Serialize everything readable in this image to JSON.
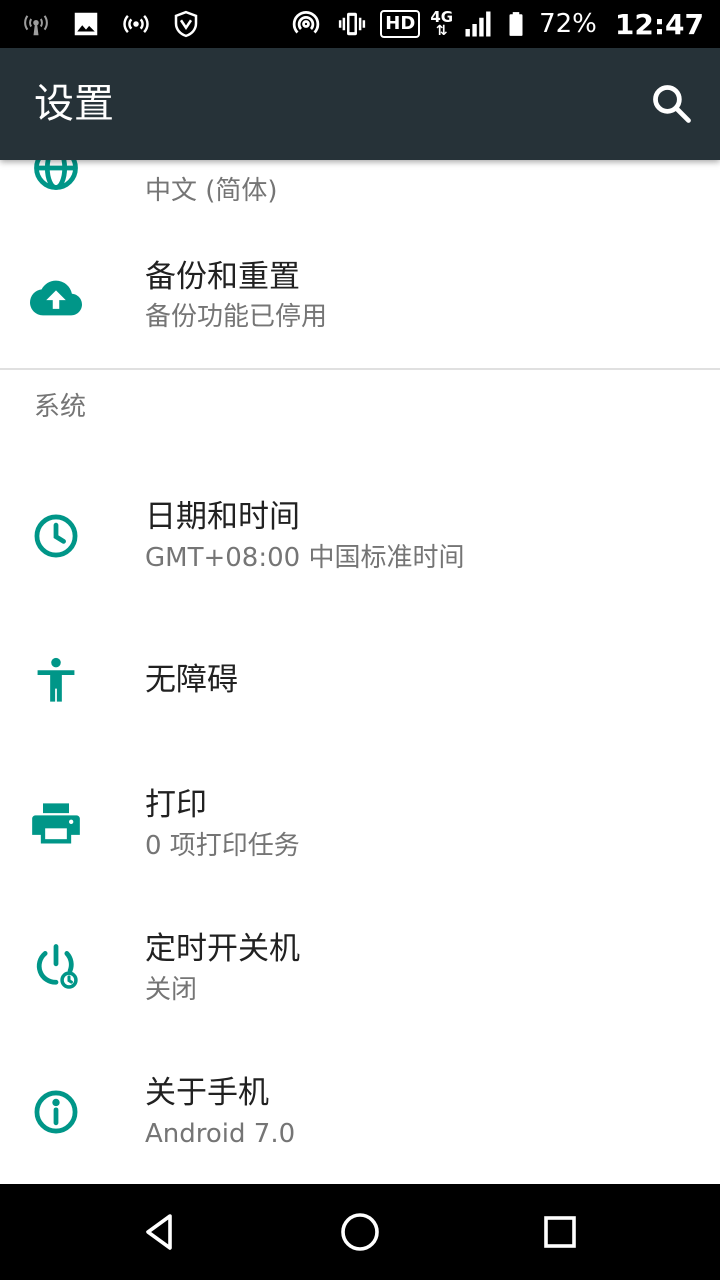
{
  "status_bar": {
    "battery_percent": "72%",
    "time": "12:47",
    "hd_label": "HD",
    "network_label": "4G",
    "icons": [
      "wifi-calling-icon",
      "image-icon",
      "hotspot-icon",
      "shield-icon",
      "nfc-icon",
      "vibrate-icon",
      "hd-icon",
      "network-icon",
      "signal-icon",
      "battery-icon"
    ]
  },
  "app_bar": {
    "title": "设置",
    "search_icon": "search-icon"
  },
  "colors": {
    "accent": "#009688",
    "app_bar": "#263238",
    "title_text": "#212121",
    "secondary_text": "#757575"
  },
  "items_top": [
    {
      "icon": "language-icon",
      "subtitle": "中文 (简体)"
    },
    {
      "icon": "cloud-upload-icon",
      "title": "备份和重置",
      "subtitle": "备份功能已停用"
    }
  ],
  "system_section": {
    "header": "系统",
    "items": [
      {
        "icon": "clock-icon",
        "title": "日期和时间",
        "subtitle": "GMT+08:00 中国标准时间"
      },
      {
        "icon": "accessibility-icon",
        "title": "无障碍"
      },
      {
        "icon": "print-icon",
        "title": "打印",
        "subtitle": "0 项打印任务"
      },
      {
        "icon": "scheduled-power-icon",
        "title": "定时开关机",
        "subtitle": "关闭"
      },
      {
        "icon": "info-icon",
        "title": "关于手机",
        "subtitle": "Android 7.0"
      }
    ]
  },
  "nav_bar": {
    "icons": [
      "back-icon",
      "home-icon",
      "recents-icon"
    ]
  }
}
